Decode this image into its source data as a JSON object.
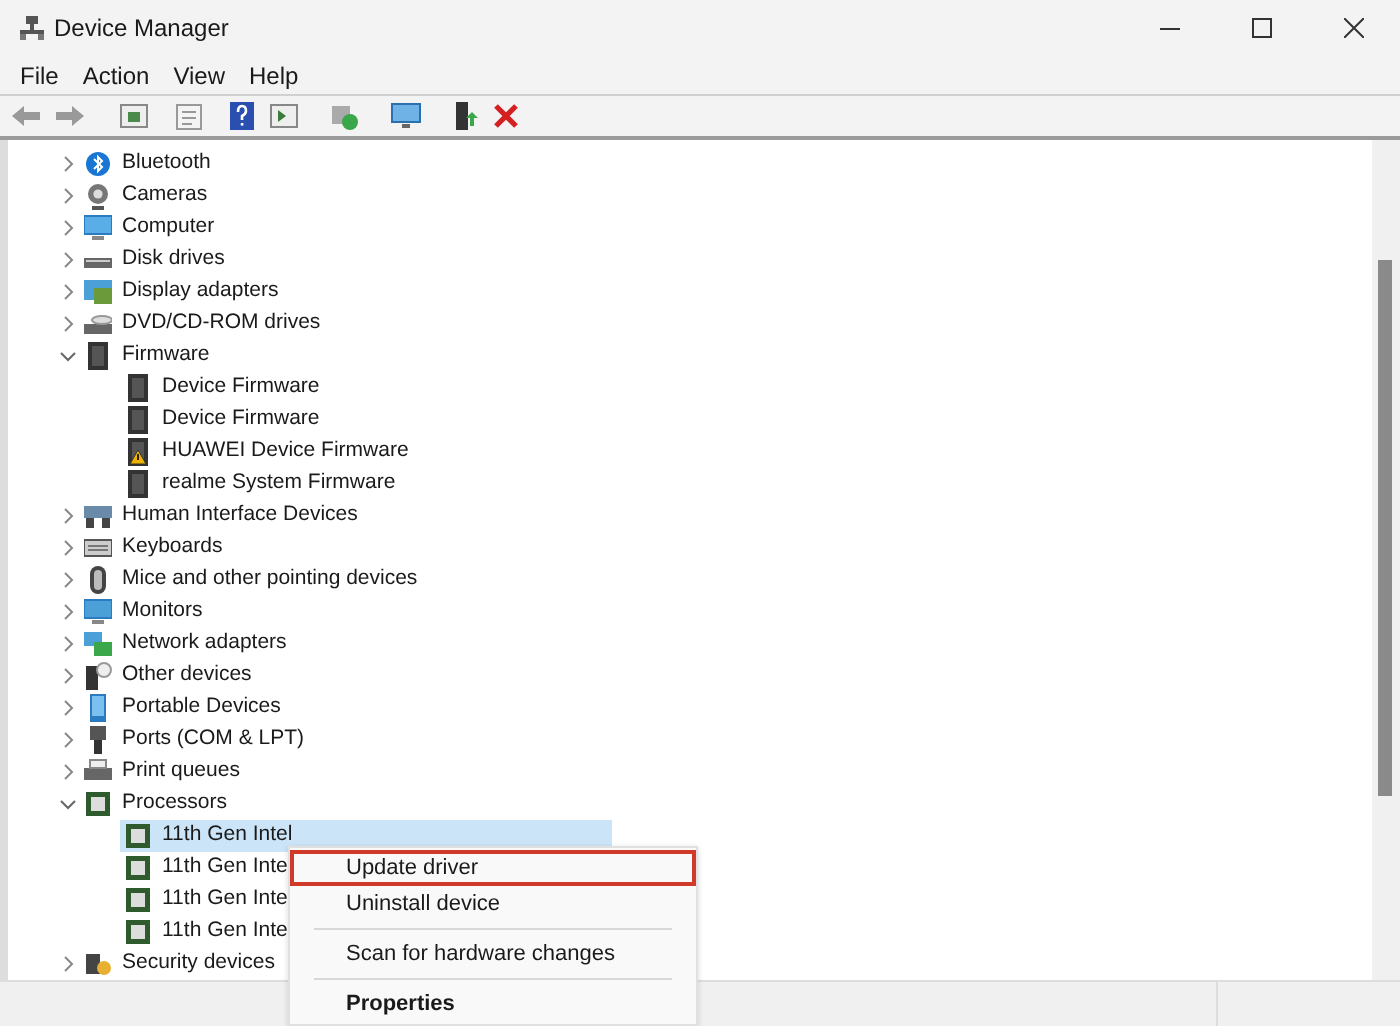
{
  "window": {
    "title": "Device Manager"
  },
  "menu": [
    "File",
    "Action",
    "View",
    "Help"
  ],
  "tree": [
    {
      "label": "Bluetooth",
      "expanded": false
    },
    {
      "label": "Cameras",
      "expanded": false
    },
    {
      "label": "Computer",
      "expanded": false
    },
    {
      "label": "Disk drives",
      "expanded": false
    },
    {
      "label": "Display adapters",
      "expanded": false
    },
    {
      "label": "DVD/CD-ROM drives",
      "expanded": false
    },
    {
      "label": "Firmware",
      "expanded": true,
      "children": [
        {
          "label": "Device Firmware",
          "selected": false,
          "warning": false
        },
        {
          "label": "Device Firmware",
          "selected": false,
          "warning": false
        },
        {
          "label": "HUAWEI Device Firmware",
          "selected": false,
          "warning": true
        },
        {
          "label": "realme System Firmware",
          "selected": false,
          "warning": false
        }
      ]
    },
    {
      "label": "Human Interface Devices",
      "expanded": false
    },
    {
      "label": "Keyboards",
      "expanded": false
    },
    {
      "label": "Mice and other pointing devices",
      "expanded": false
    },
    {
      "label": "Monitors",
      "expanded": false
    },
    {
      "label": "Network adapters",
      "expanded": false
    },
    {
      "label": "Other devices",
      "expanded": false
    },
    {
      "label": "Portable Devices",
      "expanded": false
    },
    {
      "label": "Ports (COM & LPT)",
      "expanded": false
    },
    {
      "label": "Print queues",
      "expanded": false
    },
    {
      "label": "Processors",
      "expanded": true,
      "children": [
        {
          "label": "11th Gen Intel",
          "selected": true,
          "warning": false
        },
        {
          "label": "11th Gen Inte",
          "selected": false,
          "warning": false
        },
        {
          "label": "11th Gen Inte",
          "selected": false,
          "warning": false
        },
        {
          "label": "11th Gen Inte",
          "selected": false,
          "warning": false
        }
      ]
    },
    {
      "label": "Security devices",
      "expanded": false
    }
  ],
  "context_menu": [
    {
      "label": "Update driver",
      "kind": "item",
      "highlighted": true
    },
    {
      "label": "Uninstall device",
      "kind": "item",
      "highlighted": false
    },
    {
      "kind": "separator"
    },
    {
      "label": "Scan for hardware changes",
      "kind": "item",
      "highlighted": false
    },
    {
      "kind": "separator"
    },
    {
      "label": "Properties",
      "kind": "bold",
      "highlighted": false
    }
  ]
}
